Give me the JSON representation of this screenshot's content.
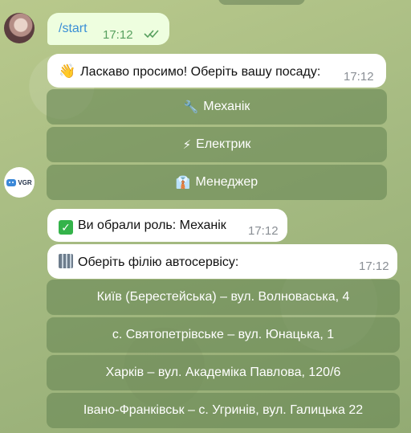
{
  "chat": {
    "user_message": {
      "text": "/start",
      "time": "17:12",
      "status": "read"
    },
    "welcome": {
      "emoji": "👋",
      "text": "Ласкаво просимо! Оберіть вашу посаду:",
      "time": "17:12"
    },
    "role_buttons": [
      {
        "emoji": "🔧",
        "label": "Механік"
      },
      {
        "emoji": "⚡",
        "label": "Електрик"
      },
      {
        "emoji": "👔",
        "label": "Менеджер"
      }
    ],
    "bot_avatar_label": "VGR",
    "role_selected": {
      "emoji": "✅",
      "text": "Ви обрали роль: Механік",
      "time": "17:12"
    },
    "branch_prompt": {
      "emoji": "🏢",
      "text": "Оберіть філію автосервісу:",
      "time": "17:12"
    },
    "branch_buttons": [
      "Київ (Берестейська) – вул. Волноваська, 4",
      "с. Святопетрівське – вул. Юнацька, 1",
      "Харків – вул. Академіка Павлова, 120/6",
      "Івано-Франківськ – с. Угринів, вул. Галицька 22"
    ]
  },
  "colors": {
    "outgoing_bubble": "#eefedf",
    "incoming_bubble": "#ffffff",
    "keyboard_button": "#6c8b57",
    "link": "#3a8fd6",
    "read_checks": "#58a05f"
  }
}
